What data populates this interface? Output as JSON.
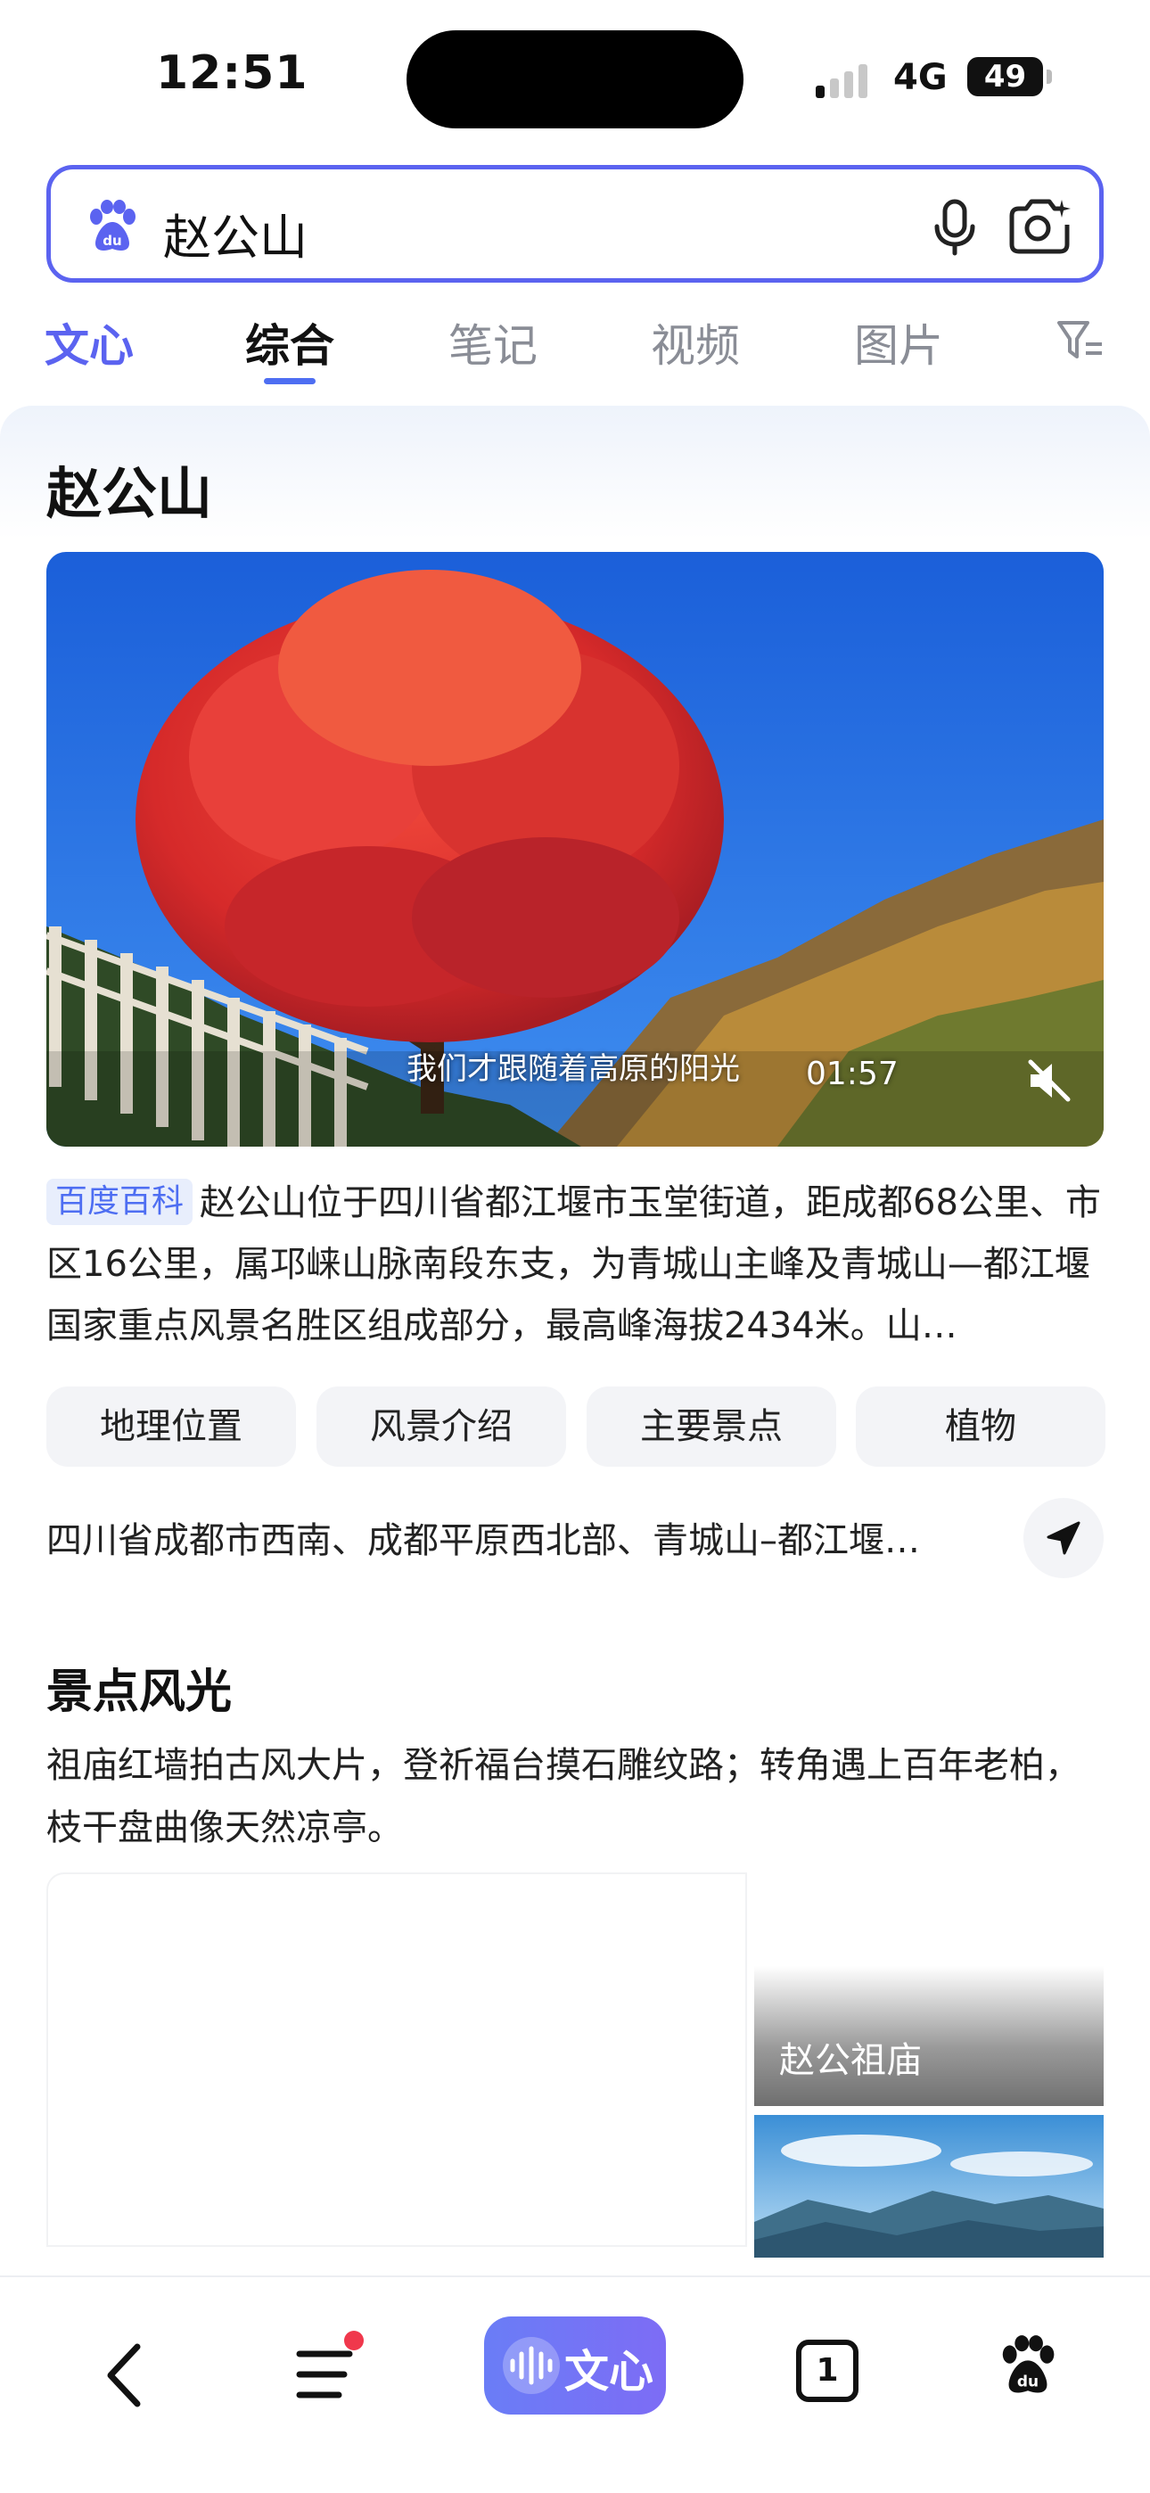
{
  "status_bar": {
    "time": "12:51",
    "network": "4G",
    "battery": "49"
  },
  "search": {
    "query": "赵公山"
  },
  "tabs": [
    {
      "label": "文心"
    },
    {
      "label": "综合"
    },
    {
      "label": "笔记"
    },
    {
      "label": "视频"
    },
    {
      "label": "图片"
    }
  ],
  "result": {
    "title": "赵公山",
    "video": {
      "subtitle": "我们才跟随着高原的阳光",
      "duration": "01:57"
    },
    "source_badge": "百度百科",
    "description": "赵公山位于四川省都江堰市玉堂街道，距成都68公里、市区16公里，属邛崃山脉南段东支，为青城山主峰及青城山—都江堰国家重点风景名胜区组成部分，最高峰海拔2434米。山…",
    "chips": [
      "地理位置",
      "风景介绍",
      "主要景点",
      "植物"
    ],
    "location": "四川省成都市西南、成都平原西北部、青城山–都江堰…"
  },
  "scenery": {
    "title": "景点风光",
    "description": "祖庙红墙拍古风大片，登祈福台摸石雕纹路；转角遇上百年老柏，枝干盘曲像天然凉亭。",
    "tile_label": "赵公祖庙"
  },
  "bottom_nav": {
    "wenxin_label": "文心",
    "tabs_count": "1"
  },
  "colors": {
    "accent": "#5b63f0",
    "link": "#4e6ef2",
    "notification": "#f0384c"
  }
}
